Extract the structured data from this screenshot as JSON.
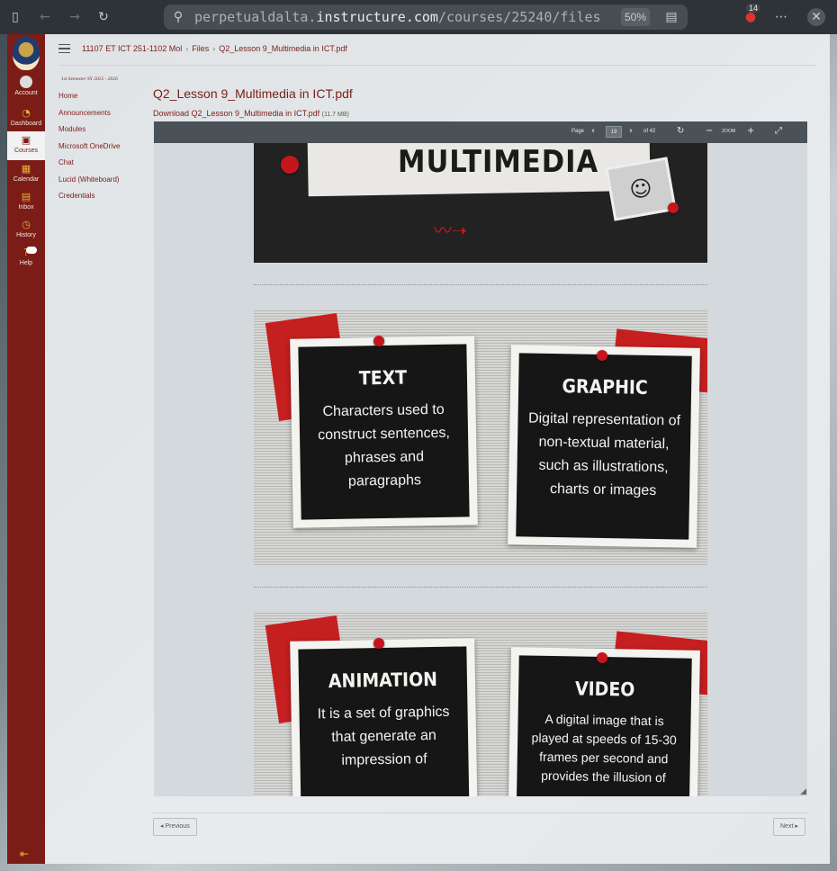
{
  "browser": {
    "url_domain": "perpetualdalta.",
    "url_host": "instructure.com",
    "url_path": "/courses/25240/files",
    "zoom": "50%",
    "notifications": "14"
  },
  "global_nav": {
    "items": [
      {
        "label": "Account",
        "icon": "account-icon"
      },
      {
        "label": "Dashboard",
        "icon": "dashboard-icon"
      },
      {
        "label": "Courses",
        "icon": "courses-icon"
      },
      {
        "label": "Calendar",
        "icon": "calendar-icon"
      },
      {
        "label": "Inbox",
        "icon": "inbox-icon"
      },
      {
        "label": "History",
        "icon": "history-icon"
      },
      {
        "label": "Help",
        "icon": "help-icon"
      }
    ]
  },
  "breadcrumb": [
    "11107 ET ICT 251-1102 Mol",
    "Files",
    "Q2_Lesson 9_Multimedia in ICT.pdf"
  ],
  "term": "1st Semester SY 2025 - 2026",
  "course_nav": [
    "Home",
    "Announcements",
    "Modules",
    "Microsoft OneDrive",
    "Chat",
    "Lucid (Whiteboard)",
    "Credentials"
  ],
  "file": {
    "title": "Q2_Lesson 9_Multimedia in ICT.pdf",
    "download_label": "Download Q2_Lesson 9_Multimedia in ICT.pdf",
    "size": "(11.7 MB)"
  },
  "viewer": {
    "page_label": "Page",
    "page_value": "19",
    "page_total": "of 42",
    "zoom_label": "ZOOM"
  },
  "slides": {
    "top_word": "MULTIMEDIA",
    "cards": [
      {
        "title": "TEXT",
        "body": "Characters used to construct sentences, phrases and paragraphs"
      },
      {
        "title": "GRAPHIC",
        "body": "Digital representation of non-textual material, such as illustrations, charts or images"
      },
      {
        "title": "ANIMATION",
        "body": "It is a set of graphics that generate an impression of"
      },
      {
        "title": "VIDEO",
        "body": "A digital image that is played at speeds of 15-30 frames per second and provides the illusion of"
      }
    ]
  },
  "pager": {
    "previous": "◂ Previous",
    "next": "Next ▸"
  }
}
